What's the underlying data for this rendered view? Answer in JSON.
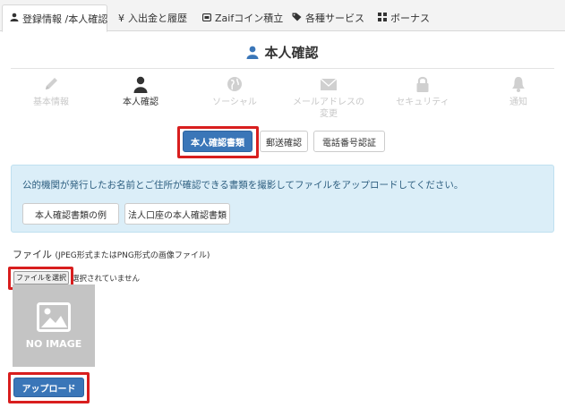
{
  "tabs": [
    {
      "label": "登録情報 /本人確認",
      "icon": "person-icon"
    },
    {
      "label": "入出金と履歴",
      "icon": "yen-icon"
    },
    {
      "label": "Zaifコイン積立",
      "icon": "piggy-bank-icon"
    },
    {
      "label": "各種サービス",
      "icon": "tag-icon"
    },
    {
      "label": "ボーナス",
      "icon": "grid-icon"
    }
  ],
  "page": {
    "title": "本人確認"
  },
  "steps": [
    {
      "label": "基本情報",
      "icon": "pencil-icon"
    },
    {
      "label": "本人確認",
      "icon": "person-icon"
    },
    {
      "label": "ソーシャル",
      "icon": "globe-icon"
    },
    {
      "label_line1": "メールアドレスの",
      "label_line2": "変更",
      "icon": "envelope-icon"
    },
    {
      "label": "セキュリティ",
      "icon": "lock-icon"
    },
    {
      "label": "通知",
      "icon": "bell-icon"
    }
  ],
  "doc_tabs": [
    "本人確認書類",
    "郵送確認",
    "電話番号認証"
  ],
  "info": {
    "message": "公的機関が発行したお名前とご住所が確認できる書類を撮影してファイルをアップロードしてください。",
    "buttons": [
      "本人確認書類の例",
      "法人口座の本人確認書類"
    ]
  },
  "file": {
    "label": "ファイル",
    "hint": "(JPEG形式またはPNG形式の画像ファイル)",
    "choose_label": "ファイルを選択",
    "status": "選択されていません"
  },
  "preview": {
    "text": "NO IMAGE"
  },
  "upload_label": "アップロード",
  "colors": {
    "primary": "#3a76b8",
    "highlight": "#d81e1e",
    "info_bg": "#dbeef8"
  }
}
